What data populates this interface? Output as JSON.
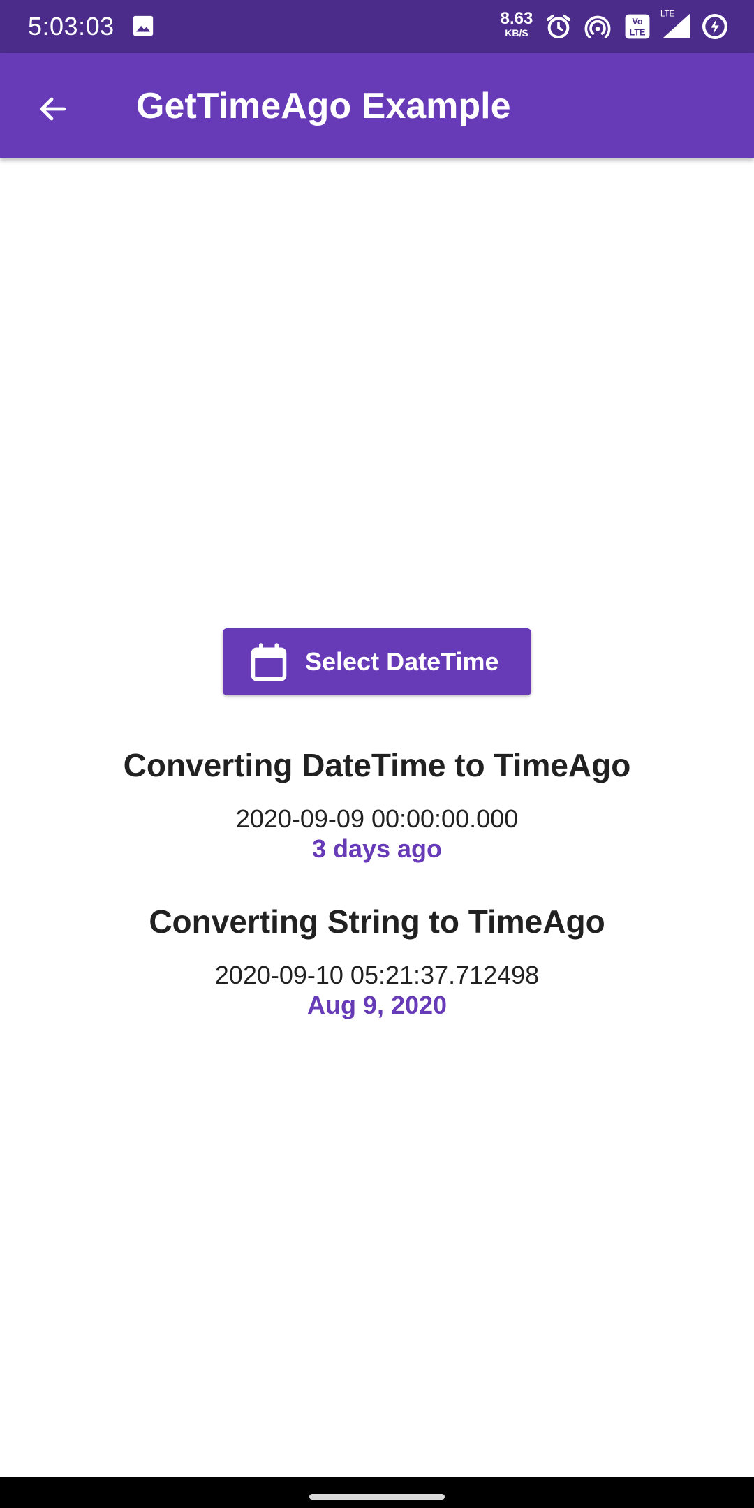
{
  "status_bar": {
    "time": "5:03:03",
    "speed_value": "8.63",
    "speed_unit": "KB/S",
    "volte_top": "Vo",
    "volte_bottom": "LTE",
    "network_label": "LTE",
    "background_color": "#4b2c8a",
    "icons": [
      "image-icon",
      "alarm-icon",
      "hotspot-icon",
      "volte-icon",
      "signal-icon",
      "battery-saver-icon"
    ]
  },
  "app_bar": {
    "title": "GetTimeAgo Example",
    "back_icon": "arrow-back-icon",
    "color": "#673ab7"
  },
  "main": {
    "select_button": {
      "label": "Select DateTime",
      "icon": "calendar-icon"
    },
    "datetime_section": {
      "heading": "Converting DateTime to TimeAgo",
      "value": "2020-09-09 00:00:00.000",
      "result": "3 days ago"
    },
    "string_section": {
      "heading": "Converting String to TimeAgo",
      "value": "2020-09-10 05:21:37.712498",
      "result": "Aug 9, 2020"
    },
    "accent_color": "#673ab7"
  }
}
